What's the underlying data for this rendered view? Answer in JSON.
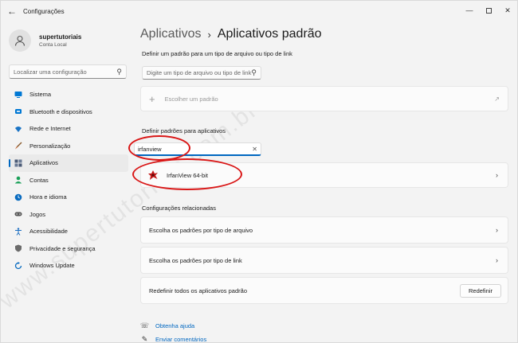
{
  "window": {
    "title": "Configurações"
  },
  "user": {
    "name": "supertutoriais",
    "account_type": "Conta Local"
  },
  "sidebar": {
    "search_placeholder": "Localizar uma configuração",
    "items": [
      {
        "label": "Sistema",
        "icon": "monitor-icon",
        "color": "#0078d4"
      },
      {
        "label": "Bluetooth e dispositivos",
        "icon": "bluetooth-icon",
        "color": "#0078d4"
      },
      {
        "label": "Rede e Internet",
        "icon": "wifi-icon",
        "color": "#1b74c5"
      },
      {
        "label": "Personalização",
        "icon": "brush-icon",
        "color": "#c05018"
      },
      {
        "label": "Aplicativos",
        "icon": "apps-icon",
        "color": "#4a5a75",
        "active": true
      },
      {
        "label": "Contas",
        "icon": "person-icon",
        "color": "#1aa058"
      },
      {
        "label": "Hora e idioma",
        "icon": "globe-clock-icon",
        "color": "#0a6cc0"
      },
      {
        "label": "Jogos",
        "icon": "gamepad-icon",
        "color": "#555555"
      },
      {
        "label": "Acessibilidade",
        "icon": "accessibility-icon",
        "color": "#1b6ec2"
      },
      {
        "label": "Privacidade e segurança",
        "icon": "shield-icon",
        "color": "#6b6b6b"
      },
      {
        "label": "Windows Update",
        "icon": "update-icon",
        "color": "#0a6cc0"
      }
    ]
  },
  "breadcrumb": {
    "parent": "Aplicativos",
    "separator": "›",
    "current": "Aplicativos padrão"
  },
  "file_type_section": {
    "label": "Definir um padrão para um tipo de arquivo ou tipo de link",
    "input_placeholder": "Digite um tipo de arquivo ou tipo de link",
    "choose_default": "Escolher um padrão"
  },
  "apps_section": {
    "label": "Definir padrões para aplicativos",
    "search_value": "irfanview",
    "result": "IrfanView 64-bit"
  },
  "related": {
    "label": "Configurações relacionadas",
    "file_type_defaults": "Escolha os padrões por tipo de arquivo",
    "link_type_defaults": "Escolha os padrões por tipo de link",
    "reset_text": "Redefinir todos os aplicativos padrão",
    "reset_button": "Redefinir"
  },
  "help": {
    "get_help": "Obtenha ajuda",
    "feedback": "Enviar comentários"
  },
  "watermark": {
    "text": "www.supertutoriais.com.br"
  },
  "colors": {
    "accent": "#0067c0",
    "annotation": "#d91616"
  }
}
